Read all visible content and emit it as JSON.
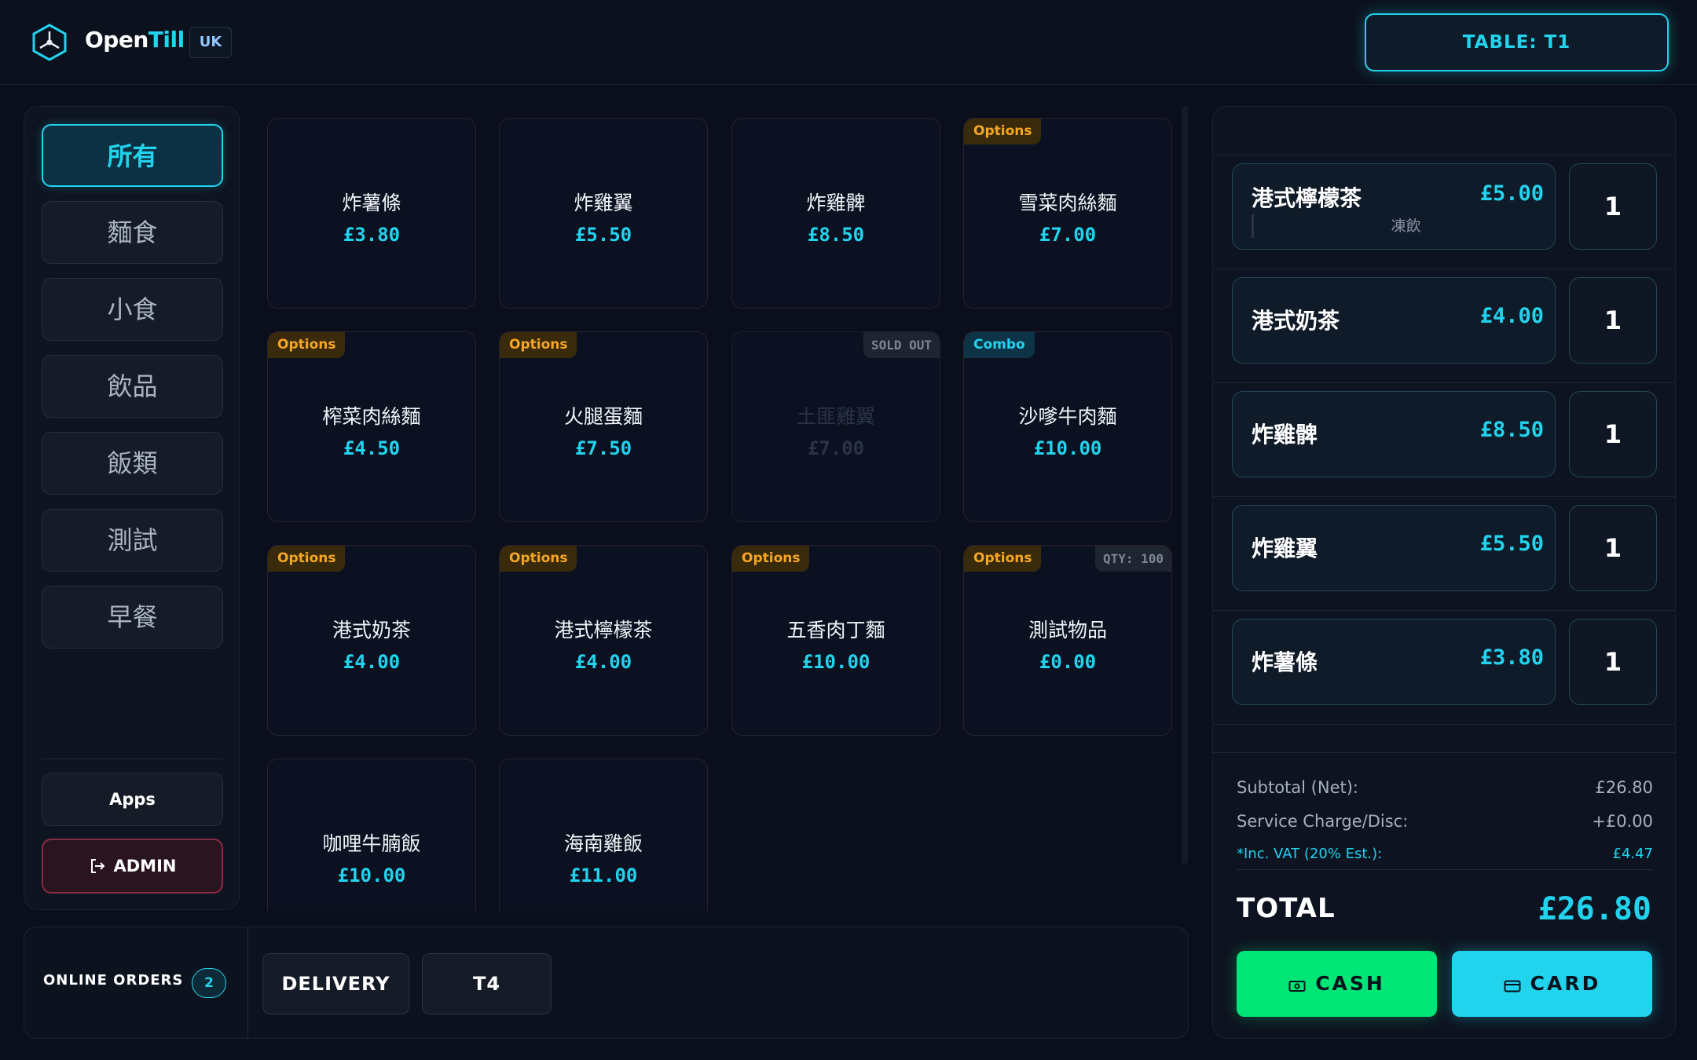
{
  "header": {
    "brand_part1": "Open",
    "brand_part2": "Till",
    "region": "UK",
    "table_button": "TABLE: T1"
  },
  "categories": [
    {
      "label": "所有",
      "active": true
    },
    {
      "label": "麵食"
    },
    {
      "label": "小食"
    },
    {
      "label": "飲品"
    },
    {
      "label": "飯類"
    },
    {
      "label": "測試"
    },
    {
      "label": "早餐"
    }
  ],
  "sidebar": {
    "apps_label": "Apps",
    "admin_label": "ADMIN"
  },
  "items": [
    {
      "name": "炸薯條",
      "price": "£3.80"
    },
    {
      "name": "炸雞翼",
      "price": "£5.50"
    },
    {
      "name": "炸雞髀",
      "price": "£8.50"
    },
    {
      "name": "雪菜肉絲麵",
      "price": "£7.00",
      "badge": "Options"
    },
    {
      "name": "榨菜肉絲麵",
      "price": "£4.50",
      "badge": "Options"
    },
    {
      "name": "火腿蛋麵",
      "price": "£7.50",
      "badge": "Options"
    },
    {
      "name": "土匪雞翼",
      "price": "£7.00",
      "status": "SOLD OUT"
    },
    {
      "name": "沙嗲牛肉麵",
      "price": "£10.00",
      "badge": "Combo"
    },
    {
      "name": "港式奶茶",
      "price": "£4.00",
      "badge": "Options"
    },
    {
      "name": "港式檸檬茶",
      "price": "£4.00",
      "badge": "Options"
    },
    {
      "name": "五香肉丁麵",
      "price": "£10.00",
      "badge": "Options"
    },
    {
      "name": "測試物品",
      "price": "£0.00",
      "badge": "Options",
      "status": "QTY: 100"
    },
    {
      "name": "咖哩牛腩飯",
      "price": "£10.00"
    },
    {
      "name": "海南雞飯",
      "price": "£11.00"
    }
  ],
  "footer": {
    "online_orders_label": "ONLINE ORDERS",
    "online_orders_count": "2",
    "delivery_label": "DELIVERY",
    "table_tab_label": "T4"
  },
  "order": {
    "lines": [
      {
        "name": "港式檸檬茶",
        "price": "£5.00",
        "modifier": "凍飲",
        "qty": "1"
      },
      {
        "name": "港式奶茶",
        "price": "£4.00",
        "qty": "1"
      },
      {
        "name": "炸雞髀",
        "price": "£8.50",
        "qty": "1"
      },
      {
        "name": "炸雞翼",
        "price": "£5.50",
        "qty": "1"
      },
      {
        "name": "炸薯條",
        "price": "£3.80",
        "qty": "1"
      }
    ],
    "subtotal_label": "Subtotal (Net):",
    "subtotal_value": "£26.80",
    "service_label": "Service Charge/Disc:",
    "service_value": "+£0.00",
    "vat_label": "*Inc. VAT (20% Est.):",
    "vat_value": "£4.47",
    "total_label": "TOTAL",
    "total_value": "£26.80",
    "cash_label": "CASH",
    "card_label": "CARD"
  },
  "colors": {
    "accent": "#22d3ee",
    "cash": "#00e676",
    "options_badge": "#f5a623",
    "background": "#0a0f1b"
  }
}
